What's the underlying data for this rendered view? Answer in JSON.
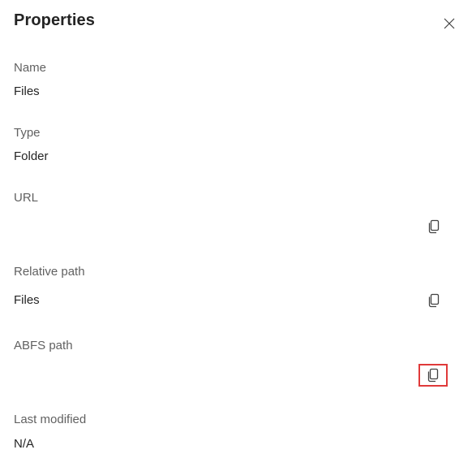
{
  "panel": {
    "title": "Properties",
    "close_icon": "close-icon"
  },
  "properties": {
    "name": {
      "label": "Name",
      "value": "Files"
    },
    "type": {
      "label": "Type",
      "value": "Folder"
    },
    "url": {
      "label": "URL",
      "value": "",
      "copy_icon": "copy-icon"
    },
    "relative_path": {
      "label": "Relative path",
      "value": "Files",
      "copy_icon": "copy-icon"
    },
    "abfs_path": {
      "label": "ABFS path",
      "value": "",
      "copy_icon": "copy-icon",
      "highlight_color": "#e03a3a"
    },
    "last_modified": {
      "label": "Last modified",
      "value": "N/A"
    }
  }
}
